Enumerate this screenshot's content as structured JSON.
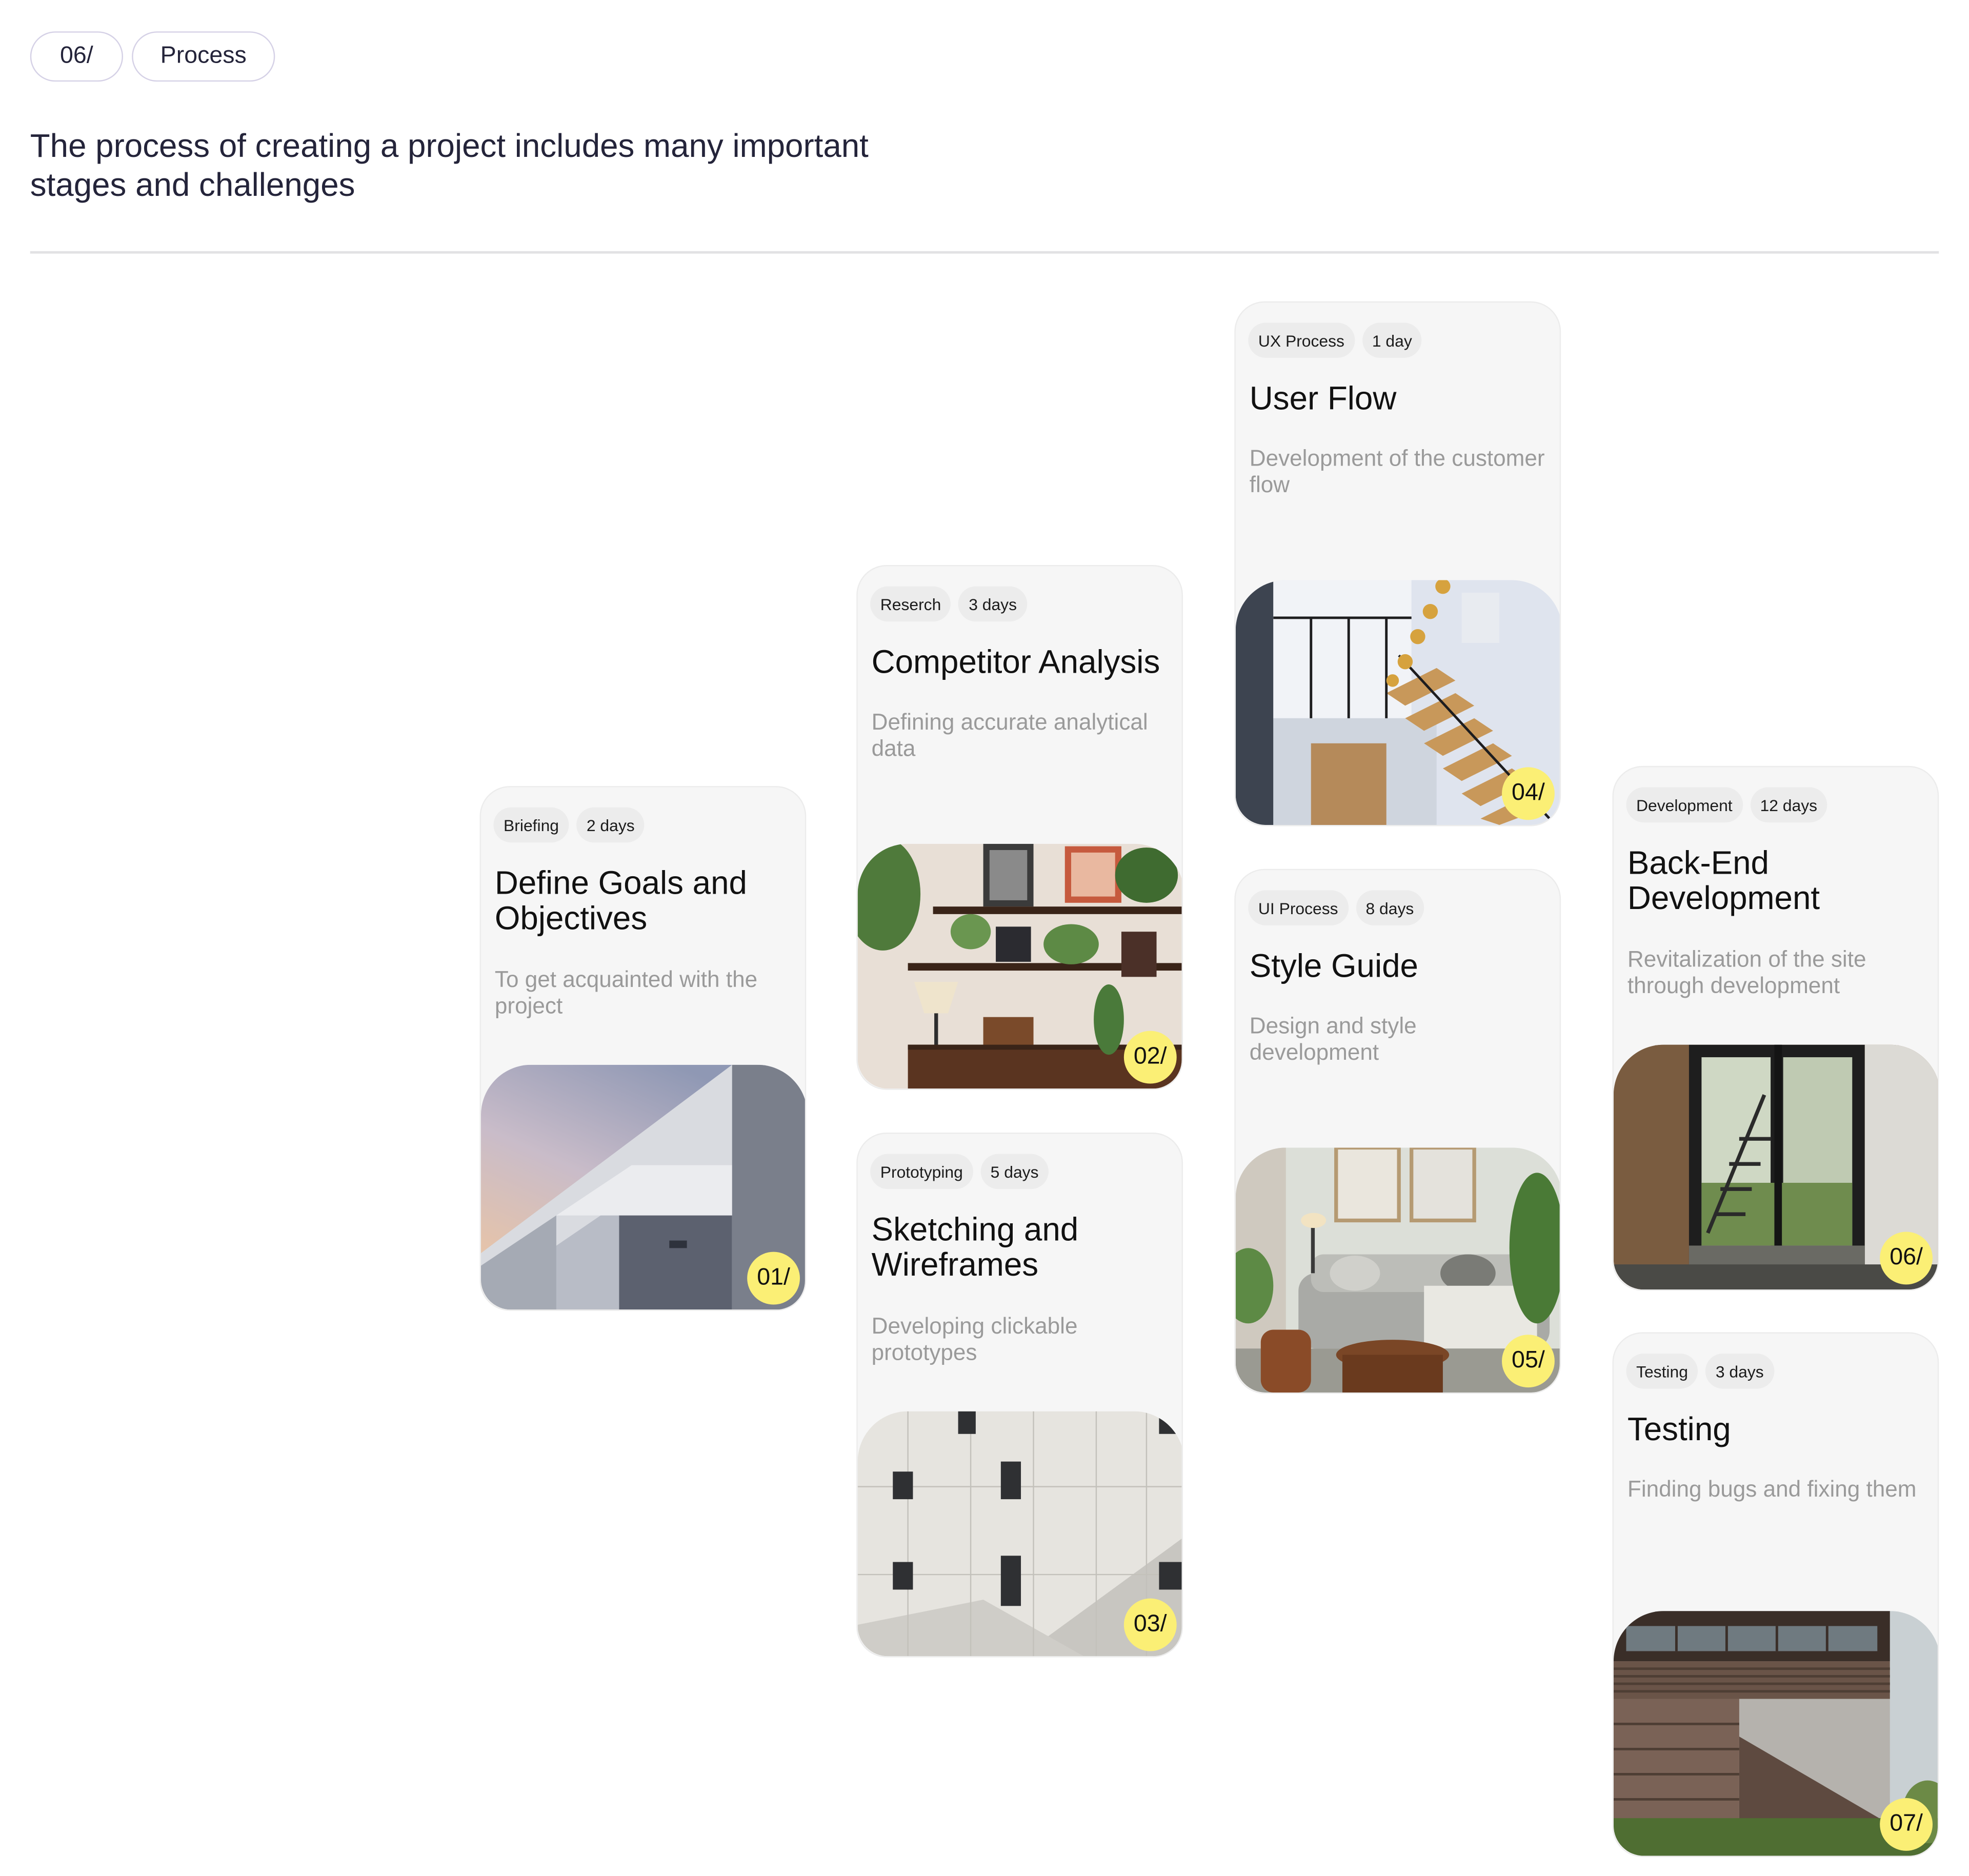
{
  "header": {
    "section_number": "06/",
    "section_label": "Process",
    "intro": "The process of creating a project includes many important stages and challenges"
  },
  "cards": [
    {
      "category": "Briefing",
      "duration": "2 days",
      "title": "Define Goals and Objectives",
      "description": "To get acquainted with the project",
      "number": "01/"
    },
    {
      "category": "Reserch",
      "duration": "3 days",
      "title": "Competitor Analysis",
      "description": "Defining accurate analytical data",
      "number": "02/"
    },
    {
      "category": "Prototyping",
      "duration": "5 days",
      "title": "Sketching and Wireframes",
      "description": "Developing clickable prototypes",
      "number": "03/"
    },
    {
      "category": "UX Process",
      "duration": "1 day",
      "title": "User Flow",
      "description": "Development of the customer flow",
      "number": "04/"
    },
    {
      "category": "UI Process",
      "duration": "8 days",
      "title": "Style Guide",
      "description": "Design and style development",
      "number": "05/"
    },
    {
      "category": "Development",
      "duration": "12 days",
      "title": "Back-End Development",
      "description": "Revitalization of the site through development",
      "number": "06/"
    },
    {
      "category": "Testing",
      "duration": "3 days",
      "title": "Testing",
      "description": "Finding bugs and fixing them",
      "number": "07/"
    }
  ]
}
